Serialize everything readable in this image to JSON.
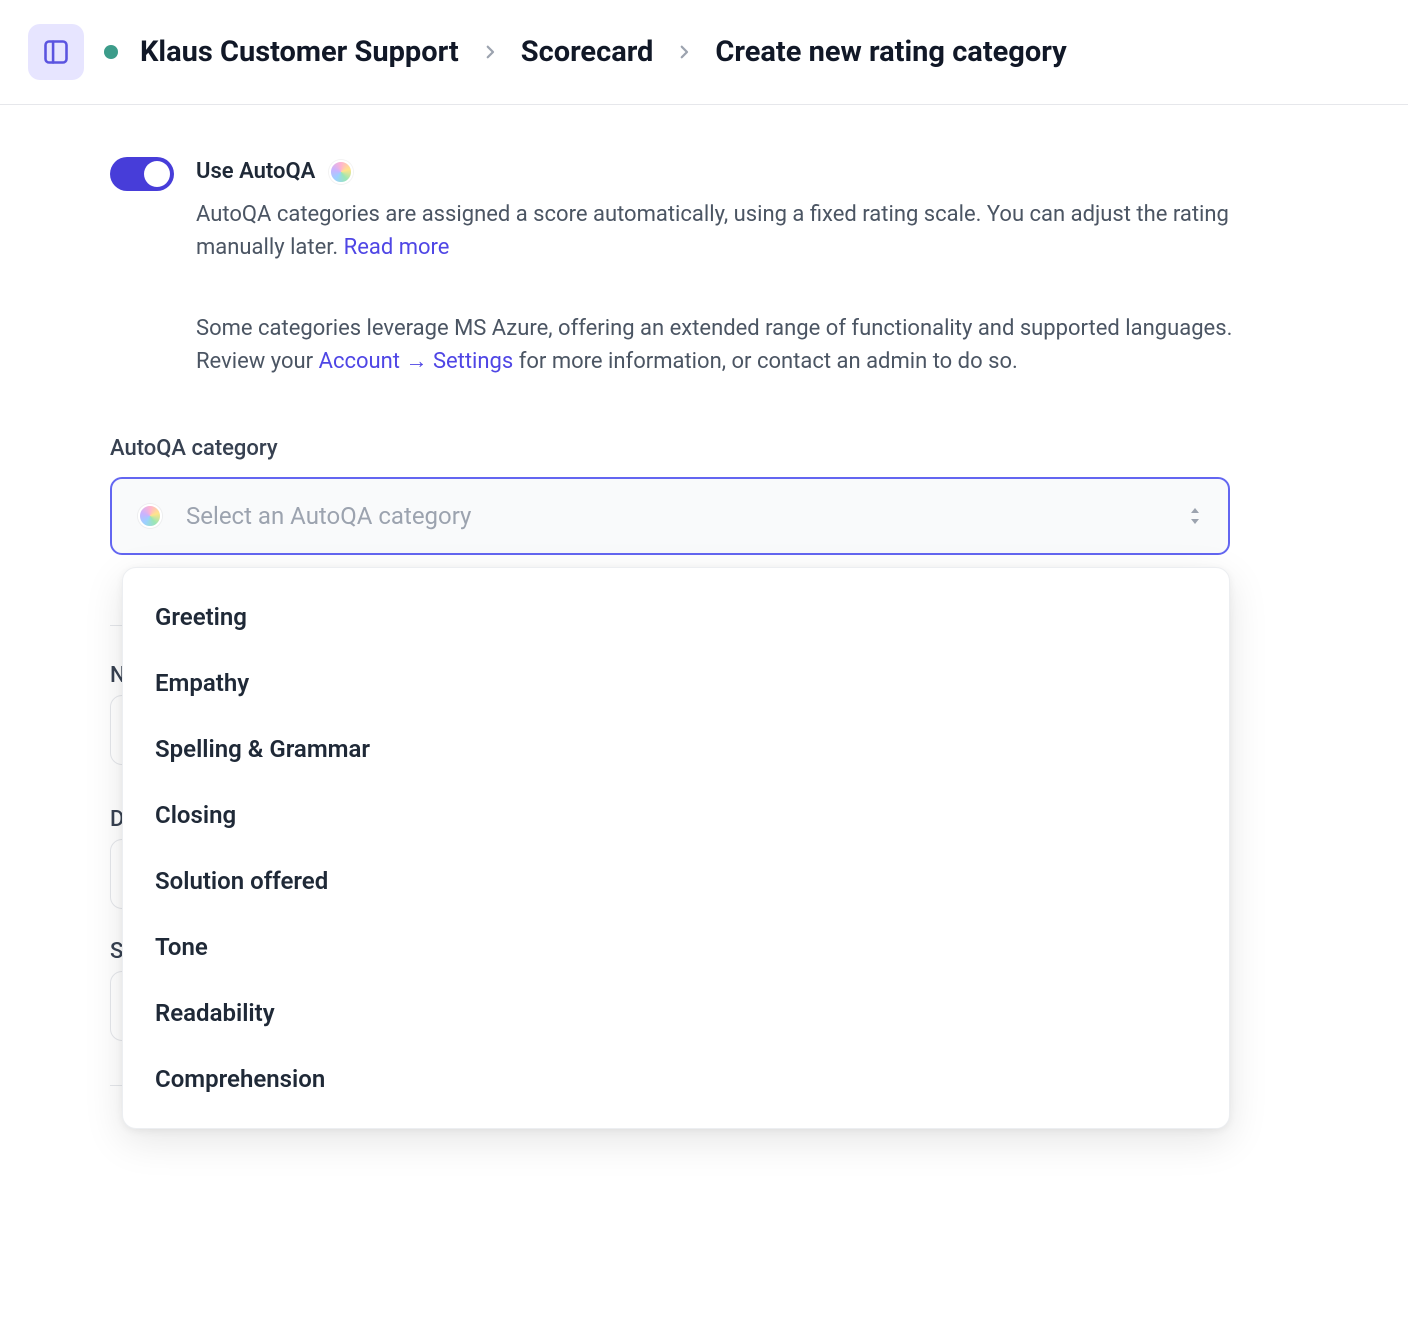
{
  "breadcrumb": {
    "workspace": "Klaus Customer Support",
    "level2": "Scorecard",
    "level3": "Create new rating category"
  },
  "autoqa": {
    "toggle_label": "Use AutoQA",
    "description_1a": "AutoQA categories are assigned a score automatically, using a fixed rating scale. You can adjust the rating manually later. ",
    "read_more": "Read more",
    "description_2a": "Some categories leverage MS Azure, offering an extended range of functionality and supported languages. Review your ",
    "account_link": "Account",
    "arrow": "→",
    "settings_link": "Settings",
    "description_2b": " for more information, or contact an admin to do so."
  },
  "select": {
    "label": "AutoQA category",
    "placeholder": "Select an AutoQA category",
    "options": [
      "Greeting",
      "Empathy",
      "Spelling & Grammar",
      "Closing",
      "Solution offered",
      "Tone",
      "Readability",
      "Comprehension"
    ]
  },
  "hidden_labels": {
    "name_initial": "N",
    "desc_initial": "D",
    "scale_initial": "S"
  }
}
